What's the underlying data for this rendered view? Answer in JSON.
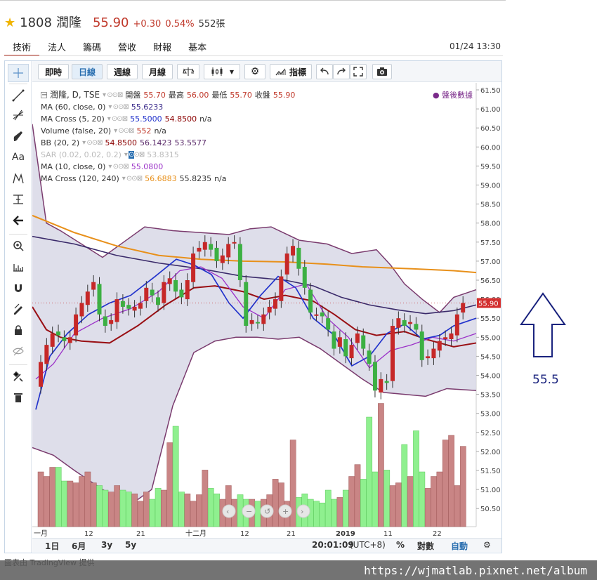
{
  "header": {
    "code": "1808",
    "name": "潤隆",
    "price": "55.90",
    "change": "+0.30",
    "change_pct": "0.54%",
    "volume": "552張",
    "datetime": "01/24 13:30"
  },
  "tabs": [
    "技術",
    "法人",
    "營收",
    "營收",
    "財報",
    "基本"
  ],
  "tabs_fixed": [
    "技術",
    "法人",
    "籌碼",
    "營收",
    "財報",
    "基本"
  ],
  "toolbar": {
    "intraday": "即時",
    "daily": "日線",
    "weekly": "週線",
    "monthly": "月線",
    "indicators": "指標"
  },
  "legend": {
    "main": "潤隆, D, TSE",
    "open_label": "開盤",
    "open": "55.70",
    "high_label": "最高",
    "high": "56.00",
    "low_label": "最低",
    "low": "55.70",
    "close_label": "收盤",
    "close": "55.90",
    "after_hours": "● 盤後數據",
    "ma60": "MA (60, close, 0)",
    "ma60_v": "55.6233",
    "macross520": "MA Cross (5, 20)",
    "macross520_v1": "55.5000",
    "macross520_v2": "54.8500",
    "macross520_v3": "n/a",
    "volume": "Volume (false, 20)",
    "volume_v1": "552",
    "volume_v2": "n/a",
    "bb": "BB (20, 2)",
    "bb_v1": "54.8500",
    "bb_v2": "56.1423",
    "bb_v3": "53.5577",
    "sar": "SAR (0.02, 0.02, 0.2)",
    "sar_v": "53.8315",
    "ma10": "MA (10, close, 0)",
    "ma10_v": "55.0800",
    "macross120": "MA Cross (120, 240)",
    "macross120_v1": "56.6883",
    "macross120_v2": "55.8235",
    "macross120_v3": "n/a"
  },
  "price_axis": [
    "61.50",
    "61.00",
    "60.50",
    "60.00",
    "59.50",
    "59.00",
    "58.50",
    "58.00",
    "57.50",
    "57.00",
    "56.50",
    "56.00",
    "55.50",
    "55.00",
    "54.50",
    "54.00",
    "53.50",
    "53.00",
    "52.50",
    "52.00",
    "51.50",
    "51.00",
    "50.50"
  ],
  "last_price_tag": "55.90",
  "time_axis": [
    "一月",
    "12",
    "21",
    "十二月",
    "12",
    "21",
    "2019",
    "11",
    "22"
  ],
  "bottom": {
    "d1": "1日",
    "m6": "6月",
    "y3": "3y",
    "y5": "5y",
    "clock": "20:01:09",
    "tz": "(UTC+8)",
    "pct": "%",
    "log": "對數",
    "auto": "自動"
  },
  "credit": "圖表由 TradingView 提供",
  "watermark": "https://wjmatlab.pixnet.net/album",
  "annotation_value": "55.5",
  "colors": {
    "up": "#c0392b",
    "down": "#3cb043",
    "accent": "#2a6fb0",
    "bb_fill": "#d8d8e6"
  }
}
